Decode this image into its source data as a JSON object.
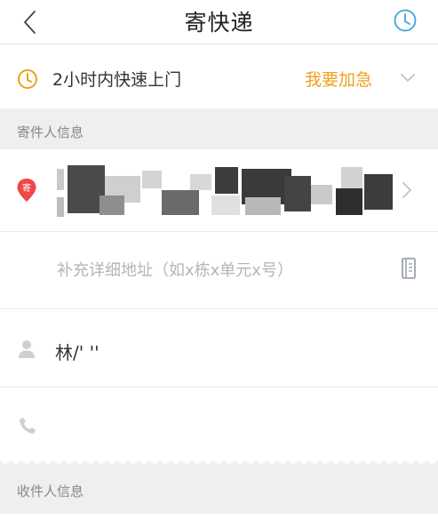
{
  "header": {
    "title": "寄快递",
    "back_icon": "chevron-left-icon",
    "history_icon": "clock-icon"
  },
  "urgent": {
    "label": "2小时内快速上门",
    "action": "我要加急",
    "icon": "clock-icon",
    "accent_color": "#f0a020"
  },
  "sender_section": {
    "label": "寄件人信息",
    "address_badge": "寄",
    "badge_color": "#f04848"
  },
  "detail_address": {
    "value": "",
    "placeholder": "补充详细地址（如x栋x单元x号）"
  },
  "sender_name": {
    "value": "林/' ''",
    "icon": "person-icon"
  },
  "sender_phone": {
    "value": "",
    "icon": "phone-icon"
  },
  "receiver_section": {
    "label": "收件人信息"
  }
}
